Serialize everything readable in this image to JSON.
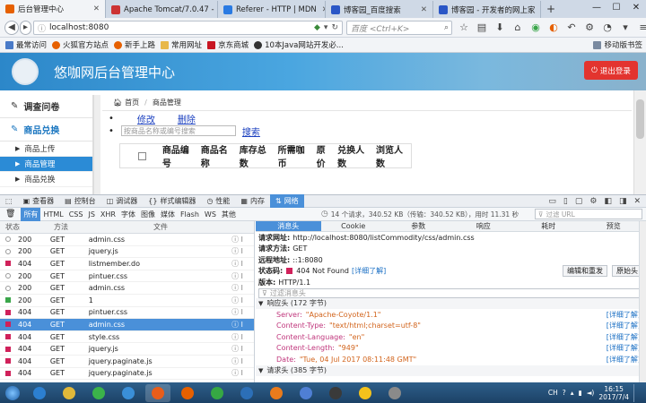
{
  "browser": {
    "tabs": [
      {
        "label": "后台管理中心",
        "active": true,
        "color": "#e66000"
      },
      {
        "label": "Apache Tomcat/7.0.47 - Er",
        "active": false,
        "color": "#c33"
      },
      {
        "label": "Referer - HTTP | MDN",
        "active": false,
        "color": "#2a7ae2"
      },
      {
        "label": "博客园_百度搜索",
        "active": false,
        "color": "#2a56c6"
      },
      {
        "label": "博客园 - 开发者的网上家",
        "active": false,
        "color": "#2a56c6"
      }
    ],
    "new_tab": "+",
    "url": "localhost:8080",
    "search_placeholder": "百度 <Ctrl+K>",
    "bookmarks": [
      "最常访问",
      "火狐官方站点",
      "新手上路",
      "常用网址",
      "京东商城",
      "10本Java网站开发必...",
      "移动版书签"
    ]
  },
  "app": {
    "title": "悠咖网后台管理中心",
    "logout_label": "退出登录",
    "sidebar": {
      "section1": "调查问卷",
      "section2": "商品兑换",
      "items": [
        "商品上传",
        "商品管理",
        "商品兑换"
      ]
    },
    "breadcrumb": {
      "home": "首页",
      "current": "商品管理"
    },
    "links": {
      "edit": "修改",
      "delete": "删除",
      "search": "搜索"
    },
    "search_placeholder": "按商品名称或编号搜索",
    "table_headers": [
      "商品编号",
      "商品名称",
      "库存总数",
      "所需咖币",
      "原价",
      "兑换人数",
      "浏览人数"
    ]
  },
  "devtools": {
    "tabs": [
      "查看器",
      "控制台",
      "调试器",
      "样式编辑器",
      "性能",
      "内存",
      "网络"
    ],
    "active_tab": "网络",
    "filters": [
      "所有",
      "HTML",
      "CSS",
      "JS",
      "XHR",
      "字体",
      "图像",
      "媒体",
      "Flash",
      "WS",
      "其他"
    ],
    "summary": "14 个请求，340.52 KB（传输：340.52 KB），用时 11.31 秒",
    "filter_placeholder": "过滤 URL",
    "columns": [
      "状态",
      "方法",
      "文件"
    ],
    "requests": [
      {
        "status": "200",
        "method": "GET",
        "file": "admin.css",
        "color": "#ffffff",
        "selected": false
      },
      {
        "status": "200",
        "method": "GET",
        "file": "jquery.js",
        "color": "#ffffff",
        "selected": false
      },
      {
        "status": "404",
        "method": "GET",
        "file": "listmember.do",
        "color": "#d0215a",
        "selected": false
      },
      {
        "status": "200",
        "method": "GET",
        "file": "pintuer.css",
        "color": "#ffffff",
        "selected": false
      },
      {
        "status": "200",
        "method": "GET",
        "file": "admin.css",
        "color": "#ffffff",
        "selected": false
      },
      {
        "status": "200",
        "method": "GET",
        "file": "1",
        "color": "#3aa64a",
        "selected": false
      },
      {
        "status": "404",
        "method": "GET",
        "file": "pintuer.css",
        "color": "#d0215a",
        "selected": false
      },
      {
        "status": "404",
        "method": "GET",
        "file": "admin.css",
        "color": "#d0215a",
        "selected": true
      },
      {
        "status": "404",
        "method": "GET",
        "file": "style.css",
        "color": "#d0215a",
        "selected": false
      },
      {
        "status": "404",
        "method": "GET",
        "file": "jquery.js",
        "color": "#d0215a",
        "selected": false
      },
      {
        "status": "404",
        "method": "GET",
        "file": "jquery.paginate.js",
        "color": "#d0215a",
        "selected": false
      },
      {
        "status": "404",
        "method": "GET",
        "file": "jquery.paginate.js",
        "color": "#d0215a",
        "selected": false
      }
    ],
    "detail_tabs": [
      "消息头",
      "Cookie",
      "参数",
      "响应",
      "耗时",
      "预览"
    ],
    "request_url_label": "请求网址:",
    "request_url": "http://localhost:8080/listCommodity/css/admin.css",
    "method_label": "请求方法:",
    "method": "GET",
    "remote_label": "远程地址:",
    "remote": "::1:8080",
    "status_label": "状态码:",
    "status_code": "404 Not Found",
    "more_label": "[详细了解]",
    "edit_resend": "编辑和重发",
    "raw_headers": "原始头",
    "version_label": "版本:",
    "version": "HTTP/1.1",
    "header_filter": "过滤消息头",
    "response_headers_title": "响应头 (172 字节)",
    "response_headers": [
      {
        "name": "Server:",
        "value": "\"Apache-Coyote/1.1\""
      },
      {
        "name": "Content-Type:",
        "value": "\"text/html;charset=utf-8\""
      },
      {
        "name": "Content-Language:",
        "value": "\"en\""
      },
      {
        "name": "Content-Length:",
        "value": "\"949\""
      },
      {
        "name": "Date:",
        "value": "\"Tue, 04 Jul 2017 08:11:48 GMT\""
      }
    ],
    "request_headers_title": "请求头 (385 字节)"
  },
  "taskbar": {
    "time": "16:15",
    "date": "2017/7/4",
    "lang": "CH",
    "icons": [
      "#2c7fd0",
      "#e0b83a",
      "#3bb34a",
      "#3a8fd8",
      "#e85d1a",
      "#e66000",
      "#36a844",
      "#2c6fb7",
      "#ea7b1c",
      "#4f7fd4",
      "#3a3a3a",
      "#f3c21c",
      "#8a8a8a"
    ]
  }
}
